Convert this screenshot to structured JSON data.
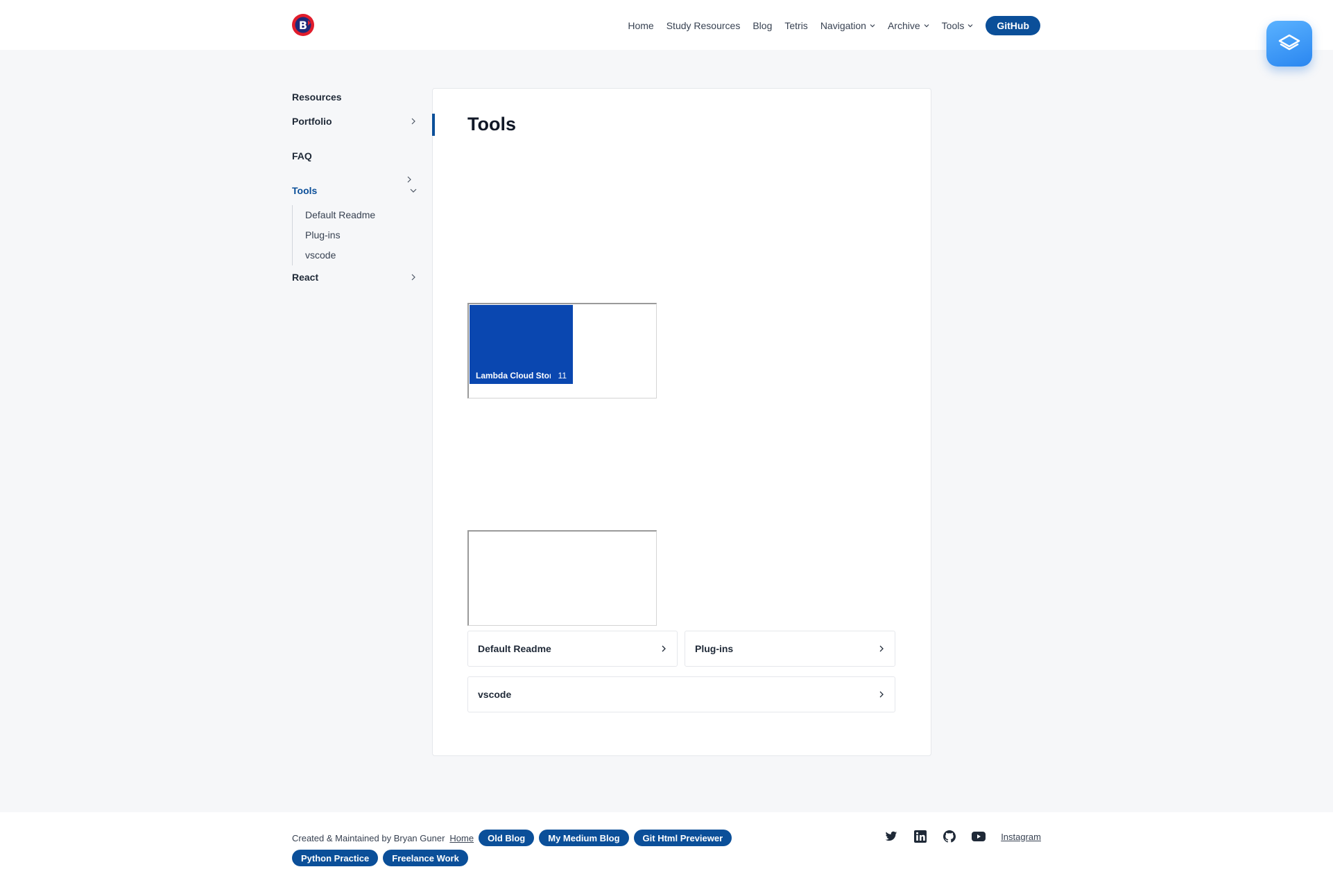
{
  "header": {
    "logo_icon": "bryan-logo-icon",
    "nav": [
      {
        "label": "Home"
      },
      {
        "label": "Study Resources"
      },
      {
        "label": "Blog"
      },
      {
        "label": "Tetris"
      },
      {
        "label": "Navigation",
        "dropdown": true
      },
      {
        "label": "Archive",
        "dropdown": true
      },
      {
        "label": "Tools",
        "dropdown": true
      }
    ],
    "github_label": "GitHub",
    "app_icon": "layers-icon"
  },
  "sidebar": {
    "items": [
      {
        "label": "Resources"
      },
      {
        "label": "Portfolio"
      },
      {
        "label": "FAQ"
      },
      {
        "label": "Tools",
        "active": true
      },
      {
        "label": "React"
      }
    ],
    "sub_items": [
      {
        "label": "Default Readme"
      },
      {
        "label": "Plug-ins"
      },
      {
        "label": "vscode"
      }
    ]
  },
  "main": {
    "title": "Tools",
    "embed_tile": {
      "label": "Lambda Cloud Stor",
      "count": "11"
    },
    "cards": [
      {
        "label": "Default Readme"
      },
      {
        "label": "Plug-ins"
      },
      {
        "label": "vscode"
      }
    ]
  },
  "footer": {
    "credit": "Created & Maintained by Bryan Guner",
    "home_link": "Home",
    "pills": [
      "Old Blog",
      "My Medium Blog",
      "Git Html Previewer",
      "Python Practice",
      "Freelance Work"
    ],
    "social_icons": [
      "twitter-icon",
      "linkedin-icon",
      "github-icon",
      "youtube-icon"
    ],
    "instagram_label": "Instagram"
  },
  "colors": {
    "accent": "#0b4f99",
    "tile": "#0a47b0",
    "background": "#f6f7f9"
  }
}
